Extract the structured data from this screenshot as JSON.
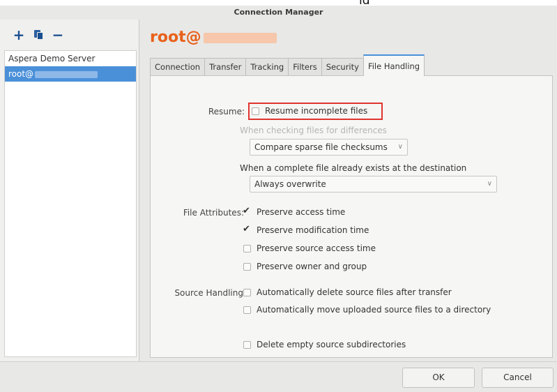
{
  "top_strip_text": "ld",
  "window": {
    "title": "Connection Manager"
  },
  "toolbar": {
    "add_label": "+",
    "remove_label": "−"
  },
  "connections": [
    {
      "label": "Aspera Demo Server",
      "selected": false
    },
    {
      "label": "root@",
      "selected": true
    }
  ],
  "header": {
    "title": "root@"
  },
  "tabs": [
    {
      "label": "Connection",
      "active": false
    },
    {
      "label": "Transfer",
      "active": false
    },
    {
      "label": "Tracking",
      "active": false
    },
    {
      "label": "Filters",
      "active": false
    },
    {
      "label": "Security",
      "active": false
    },
    {
      "label": "File Handling",
      "active": true
    }
  ],
  "resume": {
    "label": "Resume:",
    "checkbox_label": "Resume incomplete files",
    "checked": false,
    "differences_hint": "When checking files for differences",
    "differences_value": "Compare sparse file checksums",
    "exists_label": "When a complete file already exists at the destination",
    "exists_value": "Always overwrite"
  },
  "file_attributes": {
    "label": "File Attributes:",
    "options": [
      {
        "label": "Preserve access time",
        "checked": true
      },
      {
        "label": "Preserve modification time",
        "checked": true
      },
      {
        "label": "Preserve source access time",
        "checked": false
      },
      {
        "label": "Preserve owner and group",
        "checked": false
      }
    ]
  },
  "source_handling": {
    "label": "Source Handling:",
    "options": [
      {
        "label": "Automatically delete source files after transfer",
        "checked": false
      },
      {
        "label": "Automatically move uploaded source files to a directory",
        "checked": false
      },
      {
        "label": "Delete empty source subdirectories",
        "checked": false
      }
    ]
  },
  "buttons": {
    "ok": "OK",
    "cancel": "Cancel"
  },
  "colors": {
    "accent": "#e8611a",
    "selection": "#4a90d9",
    "highlight_border": "#e0342f"
  }
}
